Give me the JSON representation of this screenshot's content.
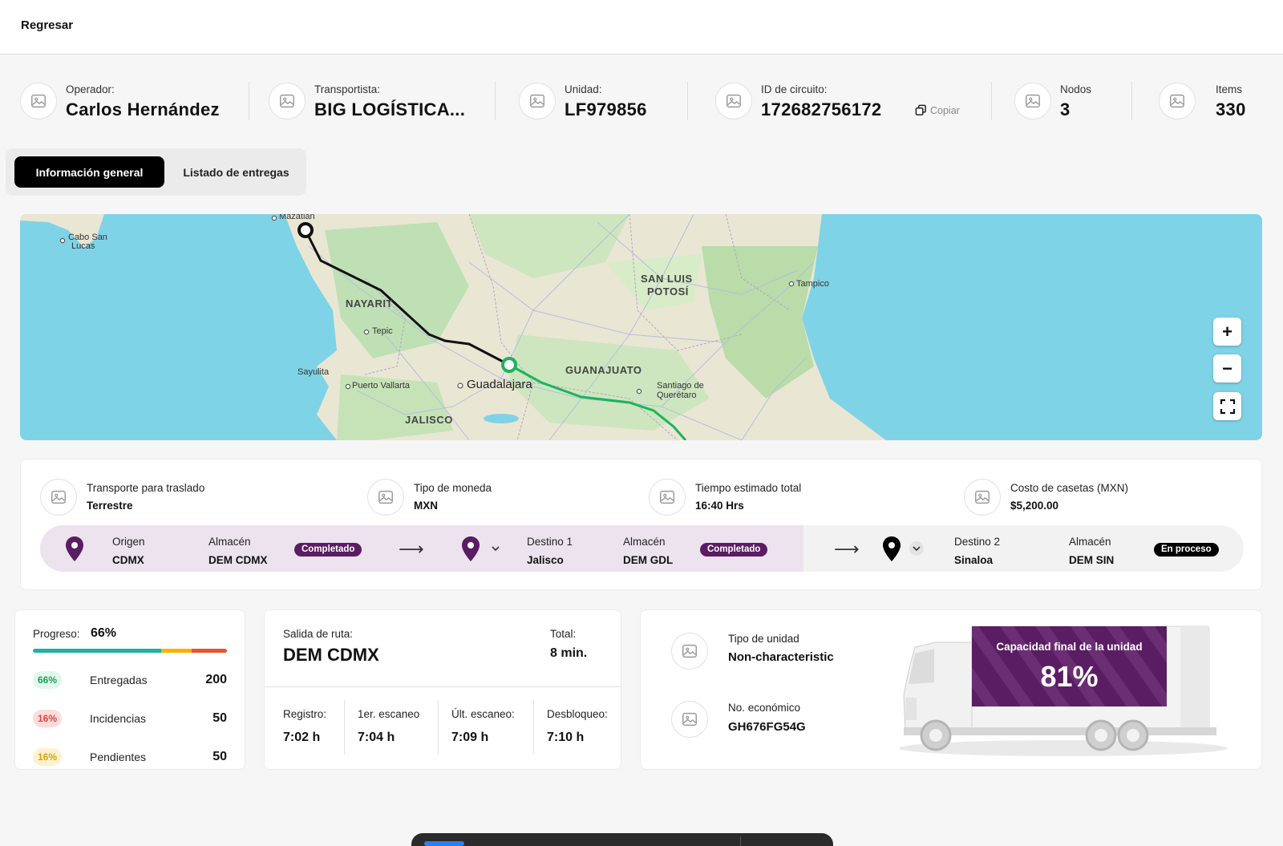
{
  "topbar": {
    "back_label": "Regresar"
  },
  "header": {
    "operator": {
      "label": "Operador:",
      "value": "Carlos Hernández"
    },
    "carrier": {
      "label": "Transportista:",
      "value": "BIG LOGÍSTICA..."
    },
    "unit": {
      "label": "Unidad:",
      "value": "LF979856"
    },
    "circuit": {
      "label": "ID de circuito:",
      "value": "172682756172",
      "copy_label": "Copiar"
    },
    "nodes": {
      "label": "Nodos",
      "value": "3"
    },
    "items": {
      "label": "Items",
      "value": "330"
    }
  },
  "tabs": [
    {
      "label": "Información general",
      "active": true
    },
    {
      "label": "Listado de entregas",
      "active": false
    }
  ],
  "map": {
    "labels": {
      "mazatlan": "Mazatlán",
      "cabo": "Cabo San",
      "cabo2": "Lucas",
      "nayarit": "NAYARIT",
      "tepic": "Tepic",
      "sayulita": "Sayulita",
      "vallarta": "Puerto Vallarta",
      "guadalajara": "Guadalajara",
      "jalisco": "JALISCO",
      "guanajuato": "GUANAJUATO",
      "slp1": "SAN LUIS",
      "slp2": "POTOSÍ",
      "tampico": "Tampico",
      "qro1": "Santiago de",
      "qro2": "Querétaro"
    },
    "route_colors": {
      "completed": "#1db35b",
      "pending": "#111111"
    },
    "controls": {
      "zoom_in": "+",
      "zoom_out": "−"
    }
  },
  "trip_info": {
    "transport": {
      "label": "Transporte para traslado",
      "value": "Terrestre"
    },
    "currency": {
      "label": "Tipo de moneda",
      "value": "MXN"
    },
    "time": {
      "label": "Tiempo estimado total",
      "value": "16:40 Hrs"
    },
    "tolls": {
      "label": "Costo de casetas (MXN)",
      "value": "$5,200.00"
    }
  },
  "route_stages": [
    {
      "title_label": "Origen",
      "title_value": "CDMX",
      "warehouse_label": "Almacén",
      "warehouse_value": "DEM CDMX",
      "status": "Completado",
      "status_color": "#5a1c63"
    },
    {
      "title_label": "Destino 1",
      "title_value": "Jalisco",
      "warehouse_label": "Almacén",
      "warehouse_value": "DEM GDL",
      "status": "Completado",
      "status_color": "#5a1c63"
    },
    {
      "title_label": "Destino 2",
      "title_value": "Sinaloa",
      "warehouse_label": "Almacén",
      "warehouse_value": "DEM SIN",
      "status": "En proceso",
      "status_color": "#000000"
    }
  ],
  "progress": {
    "label": "Progreso:",
    "value": "66%",
    "segments": [
      {
        "fraction": 0.66,
        "color": "#1db3a0"
      },
      {
        "fraction": 0.16,
        "color": "#f5b400"
      },
      {
        "fraction": 0.18,
        "color": "#e4572e"
      }
    ],
    "rows": [
      {
        "pct": "66%",
        "name": "Entregadas",
        "count": "200",
        "pill_bg": "#e3f6ec",
        "pill_fg": "#1d9e5a"
      },
      {
        "pct": "16%",
        "name": "Incidencias",
        "count": "50",
        "pill_bg": "#fbdcdc",
        "pill_fg": "#e0453a"
      },
      {
        "pct": "16%",
        "name": "Pendientes",
        "count": "50",
        "pill_bg": "#fdf1cf",
        "pill_fg": "#d9a400"
      }
    ]
  },
  "schedule": {
    "departure_label": "Salida de ruta:",
    "departure_value": "DEM CDMX",
    "total_label": "Total:",
    "total_value": "8 min.",
    "times": [
      {
        "label": "Registro:",
        "value": "7:02 h"
      },
      {
        "label": "1er. escaneo",
        "value": "7:04 h"
      },
      {
        "label": "Últ. escaneo:",
        "value": "7:09 h"
      },
      {
        "label": "Desbloqueo:",
        "value": "7:10 h"
      }
    ]
  },
  "unit_info": {
    "type_label": "Tipo de unidad",
    "type_value": "Non-characteristic",
    "eco_label": "No. económico",
    "eco_value": "GH676FG54G",
    "capacity_label": "Capacidad final de la unidad",
    "capacity_value": "81%",
    "capacity_color": "#5a1c63"
  }
}
